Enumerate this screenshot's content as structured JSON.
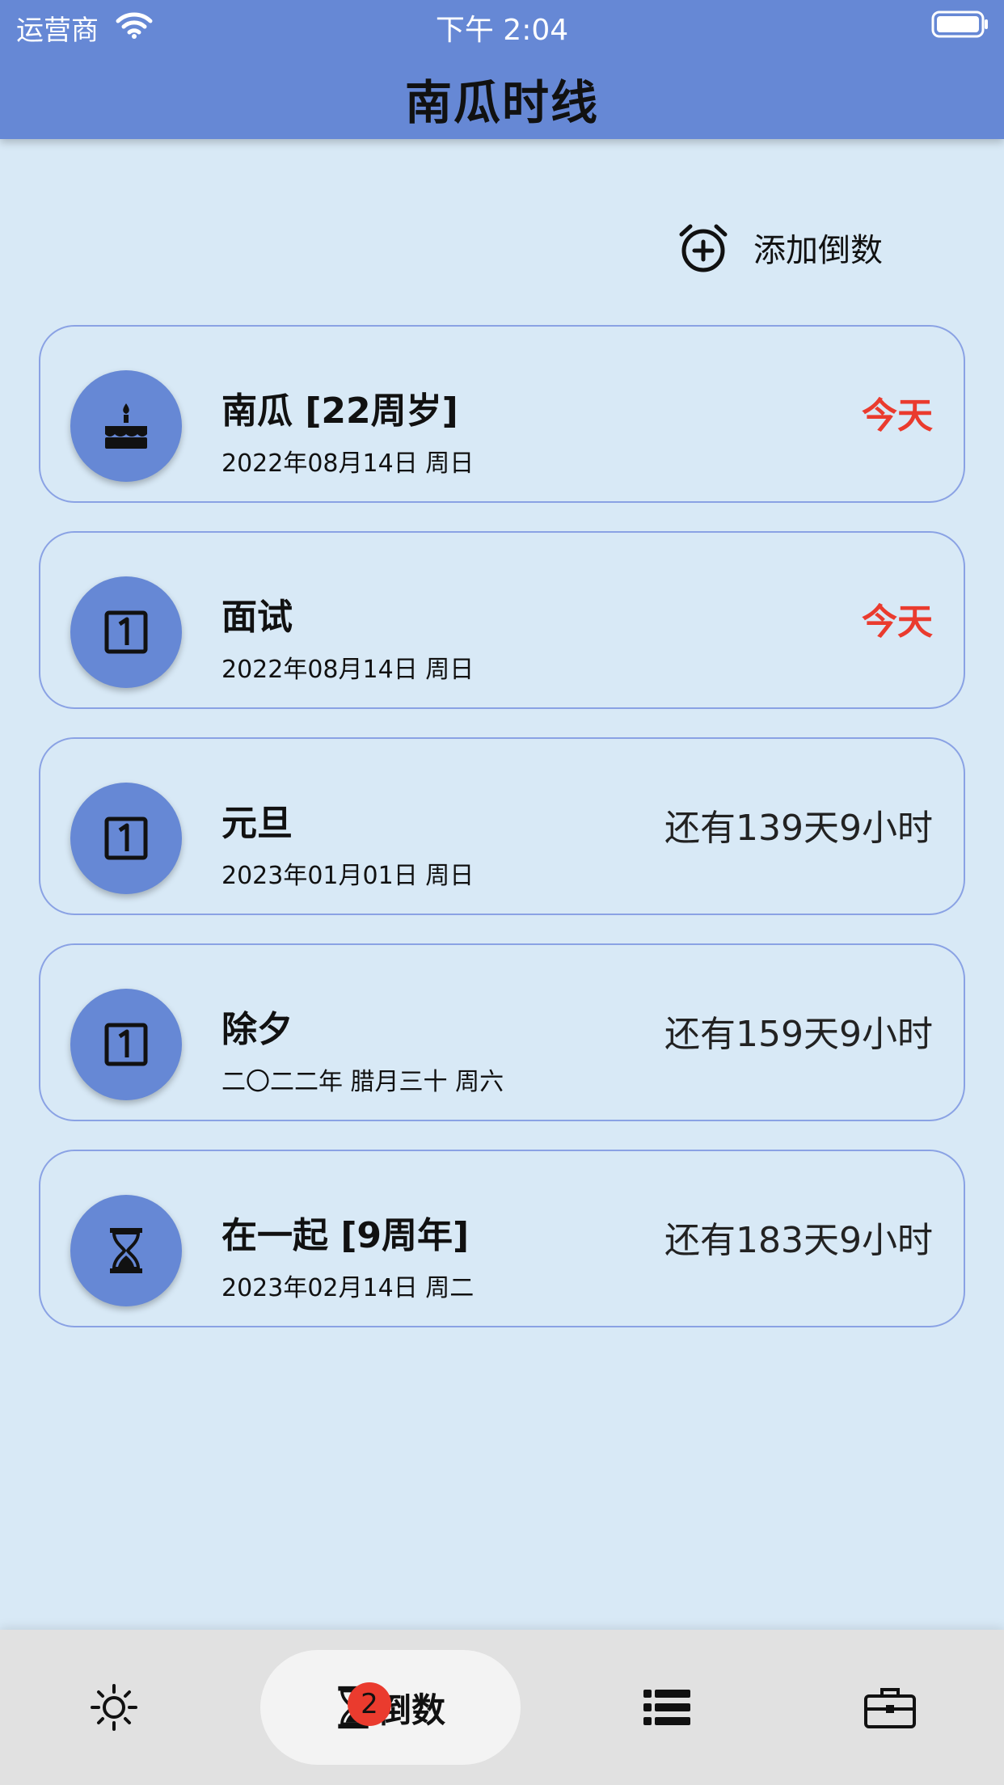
{
  "status_bar": {
    "carrier": "运营商",
    "time": "下午 2:04"
  },
  "header": {
    "title": "南瓜时线"
  },
  "toolbar": {
    "add_label": "添加倒数",
    "add_icon": "alarm-add-icon"
  },
  "events": [
    {
      "title": "南瓜 [22周岁]",
      "date": "2022年08月14日 周日",
      "status": "今天",
      "icon": "cake-icon",
      "is_today": true
    },
    {
      "title": "面试",
      "date": "2022年08月14日 周日",
      "status": "今天",
      "icon": "calendar-one-icon",
      "is_today": true
    },
    {
      "title": "元旦",
      "date": "2023年01月01日 周日",
      "status": "还有139天9小时",
      "icon": "calendar-one-icon",
      "is_today": false
    },
    {
      "title": "除夕",
      "date": "二〇二二年 腊月三十 周六",
      "status": "还有159天9小时",
      "icon": "calendar-one-icon",
      "is_today": false
    },
    {
      "title": "在一起 [9周年]",
      "date": "2023年02月14日 周二",
      "status": "还有183天9小时",
      "icon": "hourglass-icon",
      "is_today": false
    }
  ],
  "tabbar": {
    "tabs": [
      {
        "icon": "sun-icon",
        "label": ""
      },
      {
        "icon": "hourglass-icon",
        "label": "倒数",
        "badge": "2",
        "active": true
      },
      {
        "icon": "list-icon",
        "label": ""
      },
      {
        "icon": "briefcase-icon",
        "label": ""
      }
    ]
  },
  "colors": {
    "header": "#6688d5",
    "background": "#d8e9f6",
    "card_border": "#8aa2e4",
    "today": "#ea3b2e",
    "badge": "#ea3b2e"
  }
}
